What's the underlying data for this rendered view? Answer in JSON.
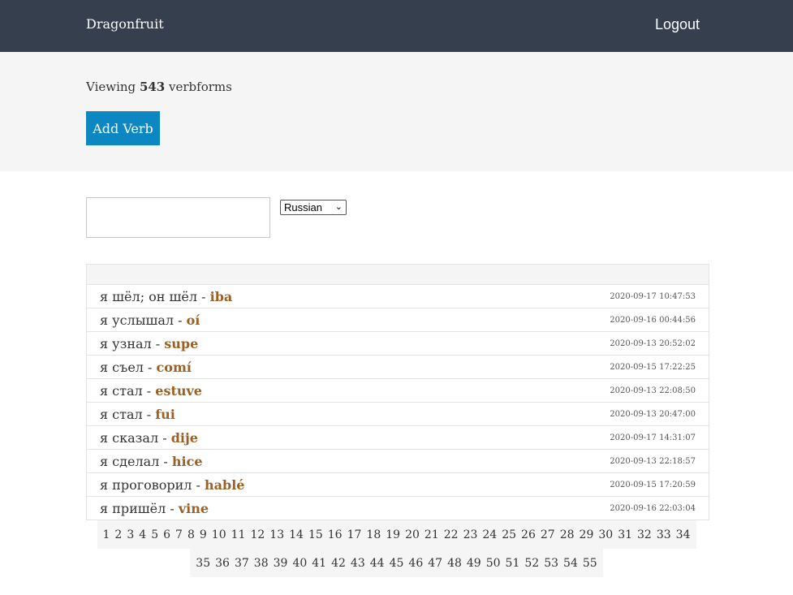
{
  "nav": {
    "brand": "Dragonfruit",
    "logout": "Logout"
  },
  "hero": {
    "viewing_prefix": "Viewing",
    "count": "543",
    "viewing_suffix": "verbforms",
    "add_button": "Add Verb"
  },
  "filters": {
    "search_value": "",
    "language": "Russian"
  },
  "rows": [
    {
      "phrase": "я шёл; он шёл - ",
      "answer": "iba",
      "timestamp": "2020-09-17 10:47:53"
    },
    {
      "phrase": "я услышал - ",
      "answer": "oí",
      "timestamp": "2020-09-16 00:44:56"
    },
    {
      "phrase": "я узнал - ",
      "answer": "supe",
      "timestamp": "2020-09-13 20:52:02"
    },
    {
      "phrase": "я съел - ",
      "answer": "comí",
      "timestamp": "2020-09-15 17:22:25"
    },
    {
      "phrase": "я стал - ",
      "answer": "estuve",
      "timestamp": "2020-09-13 22:08:50"
    },
    {
      "phrase": "я стал - ",
      "answer": "fui",
      "timestamp": "2020-09-13 20:47:00"
    },
    {
      "phrase": "я сказал - ",
      "answer": "dije",
      "timestamp": "2020-09-17 14:31:07"
    },
    {
      "phrase": "я сделал - ",
      "answer": "hice",
      "timestamp": "2020-09-13 22:18:57"
    },
    {
      "phrase": "я проговорил - ",
      "answer": "hablé",
      "timestamp": "2020-09-15 17:20:59"
    },
    {
      "phrase": "я пришёл - ",
      "answer": "vine",
      "timestamp": "2020-09-16 22:03:04"
    }
  ],
  "pagination": {
    "line1": [
      "1",
      "2",
      "3",
      "4",
      "5",
      "6",
      "7",
      "8",
      "9",
      "10",
      "11",
      "12",
      "13",
      "14",
      "15",
      "16",
      "17",
      "18",
      "19",
      "20",
      "21",
      "22",
      "23",
      "24",
      "25",
      "26",
      "27",
      "28",
      "29",
      "30",
      "31",
      "32",
      "33",
      "34"
    ],
    "line2": [
      "35",
      "36",
      "37",
      "38",
      "39",
      "40",
      "41",
      "42",
      "43",
      "44",
      "45",
      "46",
      "47",
      "48",
      "49",
      "50",
      "51",
      "52",
      "53",
      "54",
      "55"
    ]
  },
  "colors": {
    "navbar": "#363f4e",
    "accent_button": "#0d87c2",
    "answer_text": "#9a6126"
  }
}
